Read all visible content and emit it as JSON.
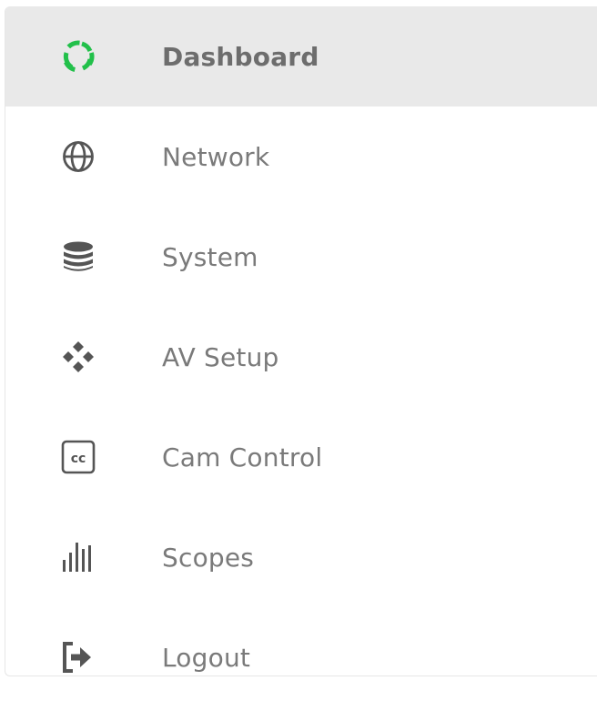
{
  "sidebar": {
    "items": [
      {
        "label": "Dashboard",
        "icon": "dashboard-ring-icon",
        "active": true
      },
      {
        "label": "Network",
        "icon": "globe-icon",
        "active": false
      },
      {
        "label": "System",
        "icon": "database-icon",
        "active": false
      },
      {
        "label": "AV Setup",
        "icon": "diamond-cluster-icon",
        "active": false
      },
      {
        "label": "Cam Control",
        "icon": "closed-caption-icon",
        "active": false
      },
      {
        "label": "Scopes",
        "icon": "audio-bars-icon",
        "active": false
      },
      {
        "label": "Logout",
        "icon": "logout-icon",
        "active": false
      }
    ]
  },
  "colors": {
    "active_background": "#e9e9e9",
    "accent_green": "#22c04a",
    "icon_gray": "#555555",
    "label_gray": "#7a7a7a"
  }
}
